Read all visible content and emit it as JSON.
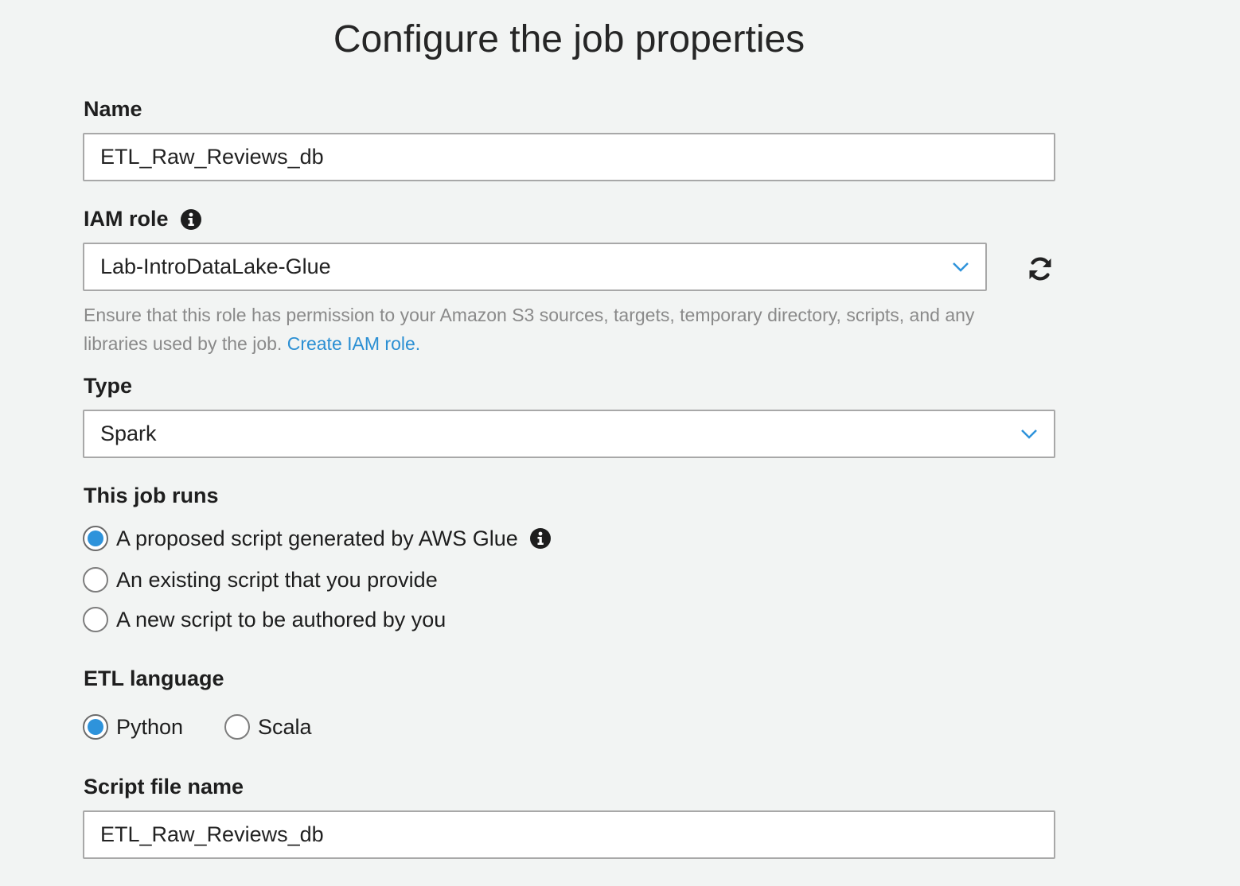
{
  "page": {
    "title": "Configure the job properties"
  },
  "name_field": {
    "label": "Name",
    "value": "ETL_Raw_Reviews_db"
  },
  "iam_role": {
    "label": "IAM role",
    "value": "Lab-IntroDataLake-Glue",
    "help_text": "Ensure that this role has permission to your Amazon S3 sources, targets, temporary directory, scripts, and any libraries used by the job.",
    "help_link": "Create IAM role."
  },
  "type_field": {
    "label": "Type",
    "value": "Spark"
  },
  "job_runs": {
    "label": "This job runs",
    "options": [
      {
        "label": "A proposed script generated by AWS Glue",
        "checked": true
      },
      {
        "label": "An existing script that you provide",
        "checked": false
      },
      {
        "label": "A new script to be authored by you",
        "checked": false
      }
    ]
  },
  "etl_language": {
    "label": "ETL language",
    "options": [
      {
        "label": "Python",
        "checked": true
      },
      {
        "label": "Scala",
        "checked": false
      }
    ]
  },
  "script_file": {
    "label": "Script file name",
    "value": "ETL_Raw_Reviews_db"
  },
  "colors": {
    "accent": "#2e93db",
    "link": "#2b8fd3",
    "background": "#f2f4f3"
  },
  "icons": [
    "info-icon",
    "chevron-down-icon",
    "refresh-icon"
  ]
}
